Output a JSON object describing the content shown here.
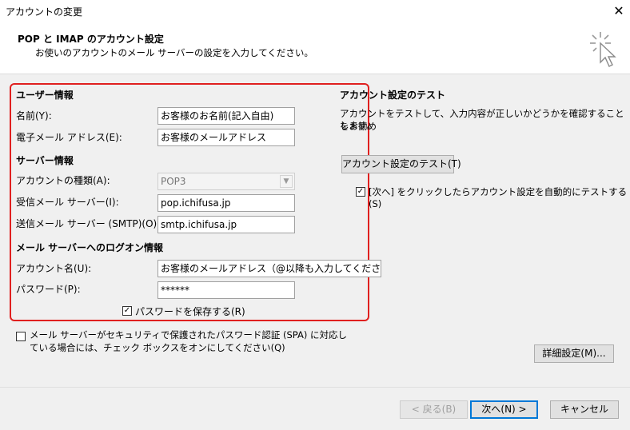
{
  "window": {
    "title": "アカウントの変更",
    "close_glyph": "✕"
  },
  "header": {
    "title": "POP と IMAP のアカウント設定",
    "subtitle": "お使いのアカウントのメール サーバーの設定を入力してください。"
  },
  "user_info": {
    "heading": "ユーザー情報",
    "name_label": "名前(Y):",
    "name_value": "お客様のお名前(記入自由)",
    "email_label": "電子メール アドレス(E):",
    "email_value": "お客様のメールアドレス"
  },
  "server_info": {
    "heading": "サーバー情報",
    "account_type_label": "アカウントの種類(A):",
    "account_type_value": "POP3",
    "incoming_label": "受信メール サーバー(I):",
    "incoming_value": "pop.ichifusa.jp",
    "outgoing_label": "送信メール サーバー (SMTP)(O):",
    "outgoing_value": "smtp.ichifusa.jp"
  },
  "logon_info": {
    "heading": "メール サーバーへのログオン情報",
    "account_name_label": "アカウント名(U):",
    "account_name_value": "お客様のメールアドレス（@以降も入力してください)",
    "password_label": "パスワード(P):",
    "password_value": "******",
    "save_password_label": "パスワードを保存する(R)",
    "save_password_checked": true
  },
  "spa": {
    "label_line1": "メール サーバーがセキュリティで保護されたパスワード認証 (SPA) に対応し",
    "label_line2": "ている場合には、チェック ボックスをオンにしてください(Q)",
    "checked": false
  },
  "test": {
    "heading": "アカウント設定のテスト",
    "desc_line1": "アカウントをテストして、入力内容が正しいかどうかを確認することをお勧め",
    "desc_line2": "します。",
    "button_label": "アカウント設定のテスト(T)",
    "auto_test_line1": "[次へ] をクリックしたらアカウント設定を自動的にテストする",
    "auto_test_line2": "(S)",
    "auto_test_checked": true
  },
  "buttons": {
    "more_settings": "詳細設定(M)...",
    "back": "< 戻る(B)",
    "next": "次へ(N) >",
    "cancel": "キャンセル"
  },
  "glyphs": {
    "check": "✓",
    "dropdown": "▼"
  }
}
